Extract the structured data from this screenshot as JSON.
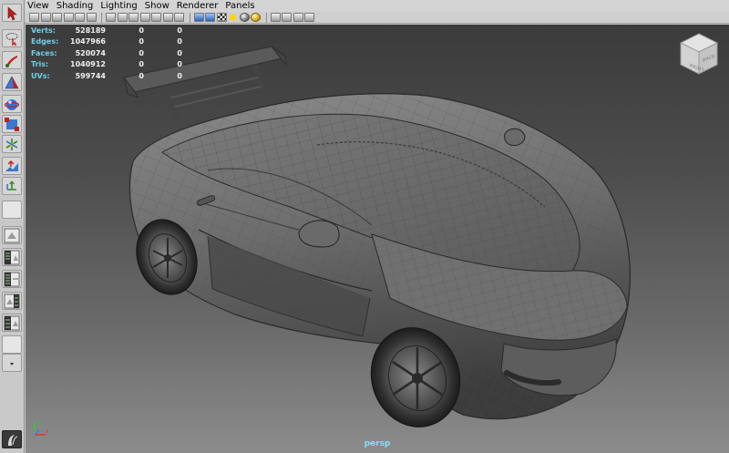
{
  "menu": [
    "View",
    "Shading",
    "Lighting",
    "Show",
    "Renderer",
    "Panels"
  ],
  "hud": {
    "rows": [
      {
        "label": "Verts:",
        "values": [
          "528189",
          "0",
          "0"
        ]
      },
      {
        "label": "Edges:",
        "values": [
          "1047966",
          "0",
          "0"
        ]
      },
      {
        "label": "Faces:",
        "values": [
          "520074",
          "0",
          "0"
        ]
      },
      {
        "label": "Tris:",
        "values": [
          "1040912",
          "0",
          "0"
        ]
      },
      {
        "label": "UVs:",
        "values": [
          "599744",
          "0",
          "0"
        ]
      }
    ]
  },
  "camera": "persp",
  "viewcube": {
    "right": "RIGHT",
    "back": "BACK"
  },
  "axis": {
    "x": "x",
    "y": "y"
  },
  "colors": {
    "hud_label": "#6fd0e8",
    "camera_label": "#7fe1ff",
    "viewport_top": "#3b3b3b",
    "viewport_bottom": "#8c8c8c"
  },
  "toolbox_icons": [
    "select-arrow-icon",
    "lasso-select-icon",
    "paint-select-icon",
    "move-tool-icon",
    "rotate-tool-icon",
    "scale-tool-icon",
    "universal-manipulator-icon",
    "soft-mod-icon",
    "show-manipulator-icon",
    "last-tool-icon",
    "single-perspective-layout-icon",
    "four-view-layout-icon",
    "persp-outliner-layout-icon",
    "persp-graph-layout-icon",
    "hypershade-layout-icon",
    "blank-layout-icon",
    "more-layouts-icon",
    "app-logo-icon"
  ]
}
